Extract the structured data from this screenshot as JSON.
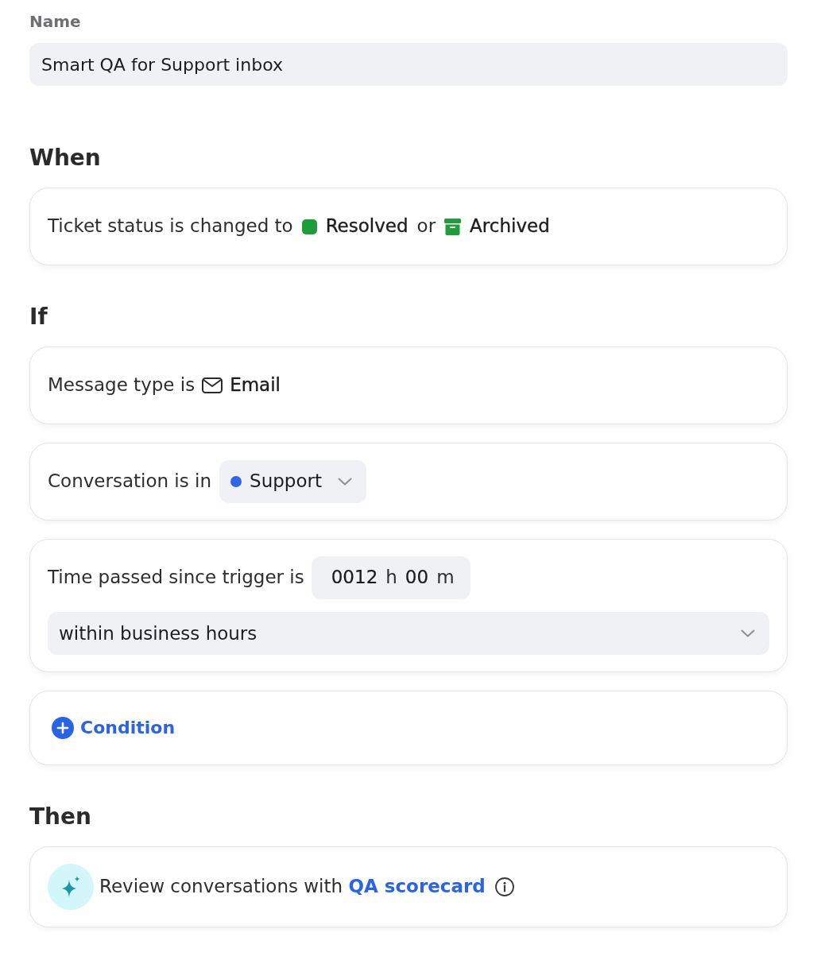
{
  "name_field": {
    "label": "Name",
    "value": "Smart QA for Support inbox"
  },
  "sections": [
    {
      "heading": "When",
      "cards": [
        {
          "kind": "status_change",
          "text": "Ticket status is changed to",
          "statuses": [
            {
              "kind": "resolved",
              "label": "Resolved"
            },
            {
              "kind": "archived",
              "label": "Archived"
            }
          ],
          "joiner": "or"
        }
      ]
    },
    {
      "heading": "If",
      "cards": [
        {
          "kind": "message_type",
          "text": "Message type is",
          "value": "Email"
        },
        {
          "kind": "team_select",
          "text": "Conversation is in",
          "value": "Support",
          "color": "#2f66e8"
        },
        {
          "kind": "duration",
          "text": "Time passed since trigger is",
          "hours": "0012",
          "hours_unit": "h",
          "minutes": "00",
          "minutes_unit": "m",
          "mode": "within business hours"
        },
        {
          "kind": "add_condition",
          "label": "Condition"
        }
      ]
    },
    {
      "heading": "Then",
      "cards": [
        {
          "kind": "action",
          "text": "Review conversations with",
          "link": "QA scorecard"
        }
      ]
    }
  ]
}
